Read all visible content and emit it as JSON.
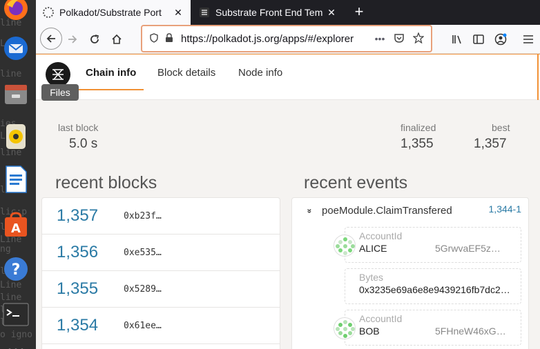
{
  "dock": {
    "background_text": [
      "line",
      "Line",
      "line",
      "ies",
      "Line",
      "line",
      "line",
      "lic:p",
      "line",
      "Line",
      "ng",
      "line",
      "Line",
      "line",
      "line",
      "line",
      "o igno"
    ],
    "items": [
      {
        "name": "firefox-icon"
      },
      {
        "name": "thunderbird-icon"
      },
      {
        "name": "files-icon"
      },
      {
        "name": "rhythmbox-icon"
      },
      {
        "name": "writer-icon"
      },
      {
        "name": "software-icon"
      },
      {
        "name": "help-icon"
      },
      {
        "name": "terminal-icon"
      },
      {
        "name": "apps-grid-icon"
      }
    ],
    "tooltip": "Files"
  },
  "browser": {
    "tabs": [
      {
        "title": "Polkadot/Substrate Port",
        "icon": "polkadot-favicon",
        "close": "✕"
      },
      {
        "title": "Substrate Front End Tem",
        "icon": "substrate-favicon",
        "close": "✕"
      }
    ],
    "new_tab": "+",
    "url": "https://polkadot.js.org/apps/#/explorer",
    "url_more": "•••"
  },
  "app": {
    "nav": [
      {
        "label": "Chain info",
        "active": true
      },
      {
        "label": "Block details",
        "active": false
      },
      {
        "label": "Node info",
        "active": false
      }
    ],
    "stats": {
      "last_block_label": "last block",
      "last_block_value": "5.0 s",
      "finalized_label": "finalized",
      "finalized_value": "1,355",
      "best_label": "best",
      "best_value": "1,357"
    },
    "recent_blocks_title": "recent blocks",
    "recent_events_title": "recent events",
    "blocks": [
      {
        "number": "1,357",
        "hash": "0xb23f…"
      },
      {
        "number": "1,356",
        "hash": "0xe535…"
      },
      {
        "number": "1,355",
        "hash": "0x5289…"
      },
      {
        "number": "1,354",
        "hash": "0x61ee…"
      }
    ],
    "event": {
      "chevron": "»",
      "title": "poeModule.ClaimTransfered",
      "id": "1,344-1",
      "params": [
        {
          "label": "AccountId",
          "value": "ALICE",
          "address": "5GrwvaEF5z…"
        },
        {
          "label": "Bytes",
          "value": "0x3235e69a6e8e9439216fb7dc2…"
        },
        {
          "label": "AccountId",
          "value": "BOB",
          "address": "5FHneW46xG…"
        }
      ]
    }
  }
}
